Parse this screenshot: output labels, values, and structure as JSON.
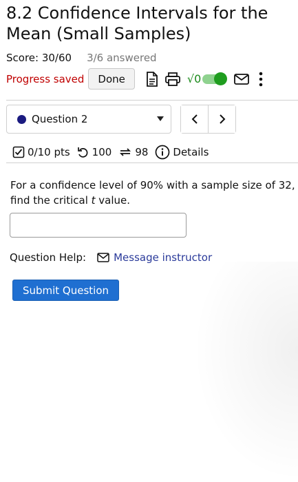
{
  "page": {
    "title": "8.2 Confidence Intervals for the Mean (Small Samples)",
    "score": "Score: 30/60",
    "answered": "3/6 answered"
  },
  "toolbar": {
    "progress_status": "Progress saved",
    "done_label": "Done",
    "sqrt_label": "√0",
    "icons": [
      "document-icon",
      "print-icon",
      "math-toggle",
      "mail-icon",
      "more-vertical-icon"
    ]
  },
  "question_nav": {
    "selected": "Question 2",
    "prev_icon": "chevron-left-icon",
    "next_icon": "chevron-right-icon"
  },
  "meta": {
    "points": "0/10 pts",
    "attempts": "100",
    "retries": "98",
    "details": "Details"
  },
  "question": {
    "text_before": "For a confidence level of 90% with a sample size of 32, find the critical ",
    "variable": "t",
    "text_after": " value.",
    "answer_value": ""
  },
  "help": {
    "label": "Question Help:",
    "link": "Message instructor"
  },
  "actions": {
    "submit_label": "Submit Question"
  },
  "colors": {
    "progress_saved": "#c00000",
    "link": "#2a3a9a",
    "submit_bg": "#1f6fd1",
    "toggle_on": "#1f9d1f",
    "question_dot": "#1a1a80"
  }
}
